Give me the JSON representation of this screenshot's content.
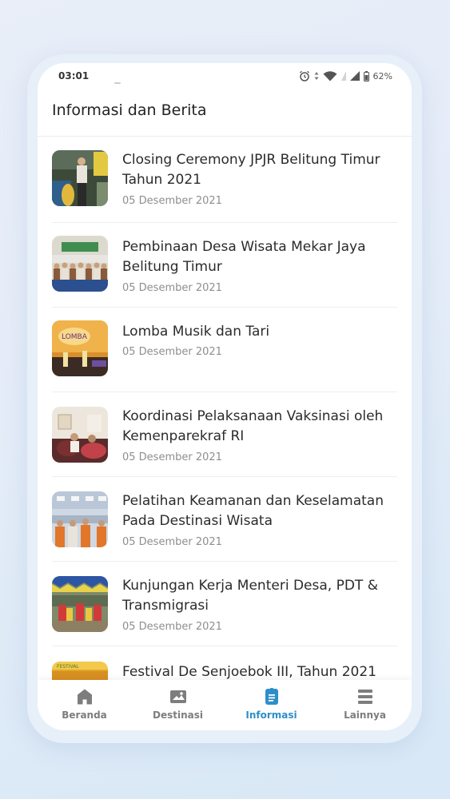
{
  "status_bar": {
    "time": "03:01",
    "battery_percent": "62%"
  },
  "header": {
    "title": "Informasi dan Berita"
  },
  "news": [
    {
      "title": "Closing Ceremony JPJR Belitung Timur Tahun 2021",
      "date": "05 Desember 2021",
      "thumbnail_icon": "ceremony-photo"
    },
    {
      "title": "Pembinaan Desa Wisata Mekar Jaya Belitung Timur",
      "date": "05 Desember 2021",
      "thumbnail_icon": "group-photo"
    },
    {
      "title": "Lomba Musik dan Tari",
      "date": "05 Desember 2021",
      "thumbnail_icon": "stage-photo"
    },
    {
      "title": "Koordinasi Pelaksanaan Vaksinasi oleh Kemenparekraf RI",
      "date": "05 Desember 2021",
      "thumbnail_icon": "meeting-photo"
    },
    {
      "title": "Pelatihan Keamanan dan Keselamatan Pada Destinasi Wisata",
      "date": "05 Desember 2021",
      "thumbnail_icon": "training-photo"
    },
    {
      "title": "Kunjungan Kerja Menteri Desa, PDT & Transmigrasi",
      "date": "05 Desember 2021",
      "thumbnail_icon": "dance-photo"
    },
    {
      "title": "Festival De Senjoebok III, Tahun 2021",
      "date": "",
      "thumbnail_icon": "festival-photo"
    }
  ],
  "bottom_nav": [
    {
      "label": "Beranda",
      "icon": "home-icon",
      "active": false
    },
    {
      "label": "Destinasi",
      "icon": "map-icon",
      "active": false
    },
    {
      "label": "Informasi",
      "icon": "document-icon",
      "active": true
    },
    {
      "label": "Lainnya",
      "icon": "menu-icon",
      "active": false
    }
  ],
  "colors": {
    "accent": "#2e8ec9",
    "inactive": "#7d7d7d"
  }
}
